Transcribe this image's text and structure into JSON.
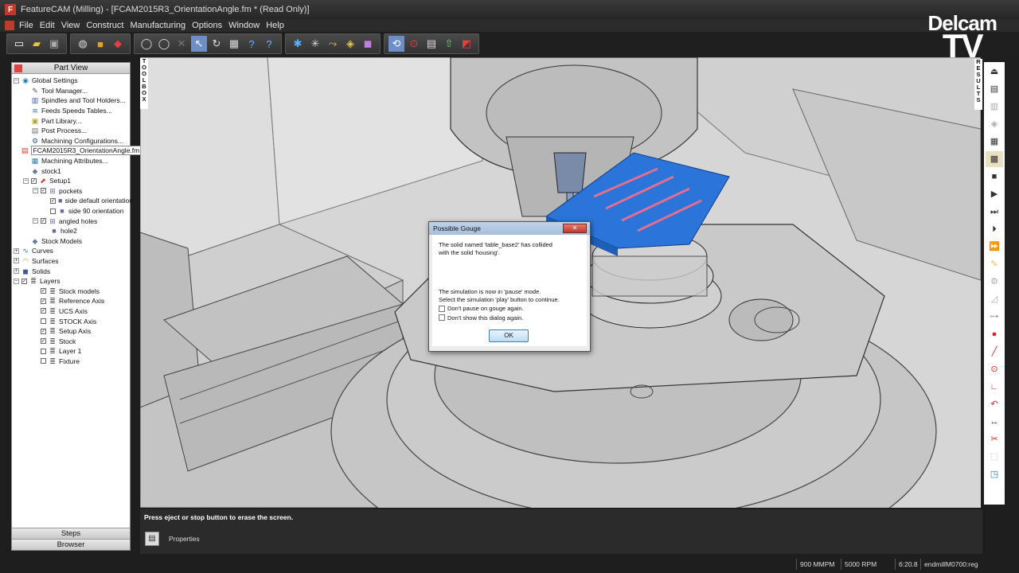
{
  "window": {
    "title": "FeatureCAM (Milling) - [FCAM2015R3_OrientationAngle.fm * (Read Only)]",
    "app_icon": "F"
  },
  "menu": [
    "File",
    "Edit",
    "View",
    "Construct",
    "Manufacturing",
    "Options",
    "Window",
    "Help"
  ],
  "logo": {
    "line1": "Delcam",
    "line2": "TV"
  },
  "left_panel": {
    "title": "Part View",
    "footer_tabs": [
      "Steps",
      "Browser"
    ],
    "tree": [
      {
        "label": "Global Settings",
        "indent": 0,
        "exp": "−",
        "icon": "globe-icon",
        "glyph": "◉",
        "color": "#2a7ab8"
      },
      {
        "label": "Tool Manager...",
        "indent": 1,
        "icon": "tool-manager-icon",
        "glyph": "✎",
        "color": "#555"
      },
      {
        "label": "Spindles and Tool Holders...",
        "indent": 1,
        "icon": "spindle-icon",
        "glyph": "▥",
        "color": "#3a5a9a"
      },
      {
        "label": "Feeds  Speeds Tables...",
        "indent": 1,
        "icon": "feeds-icon",
        "glyph": "≋",
        "color": "#2a7ab8"
      },
      {
        "label": "Part Library...",
        "indent": 1,
        "icon": "library-icon",
        "glyph": "▣",
        "color": "#b8a020"
      },
      {
        "label": "Post Process...",
        "indent": 1,
        "icon": "post-process-icon",
        "glyph": "▤",
        "color": "#6a6a6a"
      },
      {
        "label": "Machining Configurations...",
        "indent": 1,
        "icon": "machine-config-icon",
        "glyph": "⚙",
        "color": "#3a5a9a"
      },
      {
        "label": "FCAM2015R3_OrientationAngle.fm",
        "indent": 0,
        "icon": "part-file-icon",
        "glyph": "▤",
        "color": "#c0392b",
        "selected": true
      },
      {
        "label": "Machining Attributes...",
        "indent": 1,
        "icon": "attributes-icon",
        "glyph": "▦",
        "color": "#2a7ab8"
      },
      {
        "label": "stock1",
        "indent": 1,
        "icon": "stock-icon",
        "glyph": "◆",
        "color": "#6a7a9a"
      },
      {
        "label": "Setup1",
        "indent": 1,
        "exp": "−",
        "cb": true,
        "icon": "setup-icon",
        "glyph": "⬈",
        "color": "#c0392b"
      },
      {
        "label": "pockets",
        "indent": 2,
        "exp": "−",
        "cb": true,
        "icon": "pockets-icon",
        "glyph": "⊞",
        "color": "#6a6aa0"
      },
      {
        "label": "side default orientation",
        "indent": 3,
        "cb": true,
        "icon": "feature-icon",
        "glyph": "■",
        "color": "#6a6aa0"
      },
      {
        "label": "side 90 orientation",
        "indent": 3,
        "cb": false,
        "icon": "feature-icon",
        "glyph": "■",
        "color": "#6a6aa0"
      },
      {
        "label": "angled holes",
        "indent": 2,
        "exp": "−",
        "cb": true,
        "icon": "holes-icon",
        "glyph": "⊞",
        "color": "#6a6aa0"
      },
      {
        "label": "hole2",
        "indent": 3,
        "icon": "hole-icon",
        "glyph": "■",
        "color": "#6a6aa0"
      },
      {
        "label": "Stock Models",
        "indent": 1,
        "icon": "stock-models-icon",
        "glyph": "◆",
        "color": "#6a7a9a"
      },
      {
        "label": "Curves",
        "indent": 0,
        "exp": "+",
        "icon": "curves-icon",
        "glyph": "∿",
        "color": "#2a7ab8"
      },
      {
        "label": "Surfaces",
        "indent": 0,
        "exp": "+",
        "icon": "surfaces-icon",
        "glyph": "◠",
        "color": "#c0902b"
      },
      {
        "label": "Solids",
        "indent": 0,
        "exp": "+",
        "icon": "solids-icon",
        "glyph": "◼",
        "color": "#3a5a9a"
      },
      {
        "label": "Layers",
        "indent": 0,
        "exp": "−",
        "cb": true,
        "icon": "layers-icon",
        "glyph": "≣",
        "color": "#555"
      },
      {
        "label": "Stock models",
        "indent": 2,
        "cb": true,
        "icon": "layer-icon",
        "glyph": "≣",
        "color": "#555"
      },
      {
        "label": "Reference Axis",
        "indent": 2,
        "cb": true,
        "icon": "layer-icon",
        "glyph": "≣",
        "color": "#555"
      },
      {
        "label": "UCS Axis",
        "indent": 2,
        "cb": true,
        "icon": "layer-icon",
        "glyph": "≣",
        "color": "#555"
      },
      {
        "label": "STOCK Axis",
        "indent": 2,
        "cb": false,
        "icon": "layer-icon",
        "glyph": "≣",
        "color": "#555"
      },
      {
        "label": "Setup Axis",
        "indent": 2,
        "cb": true,
        "icon": "layer-icon",
        "glyph": "≣",
        "color": "#555"
      },
      {
        "label": "Stock",
        "indent": 2,
        "cb": true,
        "icon": "layer-icon",
        "glyph": "≣",
        "color": "#555"
      },
      {
        "label": "Layer 1",
        "indent": 2,
        "cb": false,
        "icon": "layer-icon",
        "glyph": "≣",
        "color": "#555"
      },
      {
        "label": "Fixture",
        "indent": 2,
        "cb": false,
        "icon": "layer-icon",
        "glyph": "≣",
        "color": "#555"
      }
    ]
  },
  "toolbox_tab": "TOOLBOX",
  "results_tab": "RESULTS",
  "dialog": {
    "title": "Possible Gouge",
    "message1": "The solid named 'table_base2' has collided with the solid 'housing'.",
    "message2": "The simulation is now in 'pause' mode.",
    "message3": "Select the simulation 'play' button to continue.",
    "check1": "Don't pause on gouge again.",
    "check2": "Don't show this dialog again.",
    "ok_label": "OK",
    "close_label": "✕"
  },
  "bottom": {
    "status_message": "Press eject or stop button to erase the screen.",
    "properties_label": "Properties"
  },
  "statusbar": {
    "feed": "900 MMPM",
    "speed": "5000 RPM",
    "time": "6:20.8",
    "tool": "endmillM0700:reg"
  }
}
